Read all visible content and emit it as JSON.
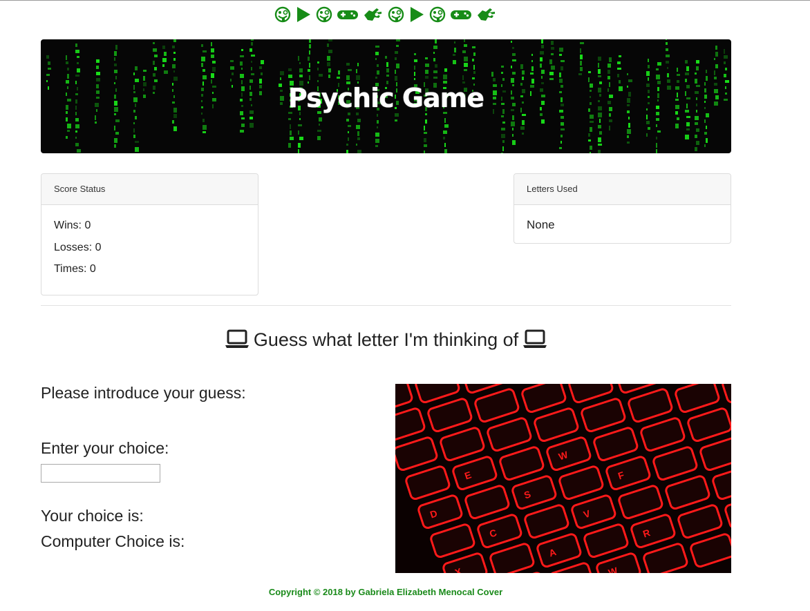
{
  "header": {
    "icons": [
      "zany-face-icon",
      "play-icon",
      "zany-face-icon",
      "gamepad-icon",
      "hand-icon",
      "zany-face-icon",
      "play-icon",
      "zany-face-icon",
      "gamepad-icon",
      "hand-icon"
    ],
    "icon_color": "#178c17"
  },
  "banner": {
    "title": "Psychic Game",
    "background_color": "#060606",
    "rain_color": "#19e019"
  },
  "score_card": {
    "title": "Score Status",
    "wins": "Wins: 0",
    "losses": "Losses: 0",
    "times": "Times: 0"
  },
  "letters_card": {
    "title": "Letters Used",
    "value": "None"
  },
  "headline": {
    "text": "Guess what letter I'm thinking of",
    "icon": "laptop-icon"
  },
  "form": {
    "prompt": "Please introduce your guess:",
    "enter_label": "Enter your choice:",
    "input_value": "",
    "your_choice": "Your choice is:",
    "computer_choice": "Computer Choice is:"
  },
  "photo": {
    "key_letters": [
      "E",
      "W",
      "D",
      "S",
      "F",
      "C",
      "V",
      "X",
      "A",
      "R"
    ],
    "glow_color": "#ff1a1a"
  },
  "footer": {
    "text": "Copyright © 2018 by Gabriela Elizabeth Menocal Cover"
  }
}
